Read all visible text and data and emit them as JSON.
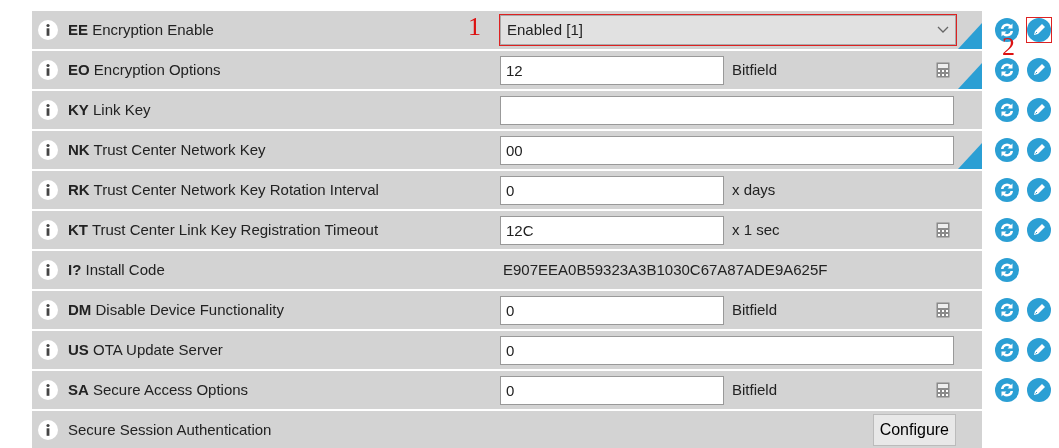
{
  "settings": [
    {
      "code": "EE",
      "label": "Encryption Enable",
      "kind": "select",
      "value": "Enabled [1]",
      "modified": true,
      "writable": true
    },
    {
      "code": "EO",
      "label": "Encryption Options",
      "kind": "input",
      "value": "12",
      "unit": "Bitfield",
      "calculator": true,
      "modified": true,
      "writable": true
    },
    {
      "code": "KY",
      "label": "Link Key",
      "kind": "input",
      "modified": false,
      "writable": true
    },
    {
      "code": "NK",
      "label": "Trust Center Network Key",
      "kind": "input",
      "value": "00",
      "modified": true,
      "writable": true
    },
    {
      "code": "RK",
      "label": "Trust Center Network Key Rotation Interval",
      "kind": "input",
      "value": "0",
      "unit": "x days",
      "calculator": false,
      "modified": false,
      "writable": true
    },
    {
      "code": "KT",
      "label": "Trust Center Link Key Registration Timeout",
      "kind": "input",
      "value": "12C",
      "unit": "x 1 sec",
      "calculator": true,
      "modified": false,
      "writable": true
    },
    {
      "code": "I?",
      "label": "Install Code",
      "kind": "readonly",
      "value": "E907EEA0B59323A3B1030C67A87ADE9A625F",
      "modified": false,
      "writable": false
    },
    {
      "code": "DM",
      "label": "Disable Device Functionality",
      "kind": "input",
      "value": "0",
      "unit": "Bitfield",
      "calculator": true,
      "modified": false,
      "writable": true
    },
    {
      "code": "US",
      "label": "OTA Update Server",
      "kind": "input",
      "value": "0",
      "modified": false,
      "writable": true
    },
    {
      "code": "SA",
      "label": "Secure Access Options",
      "kind": "input",
      "value": "0",
      "unit": "Bitfield",
      "calculator": true,
      "modified": false,
      "writable": true
    },
    {
      "label": "Secure Session Authentication",
      "kind": "button",
      "value": "Configure",
      "modified": false,
      "writable": false
    }
  ],
  "annotations": [
    {
      "text": "1"
    },
    {
      "text": "2"
    }
  ]
}
